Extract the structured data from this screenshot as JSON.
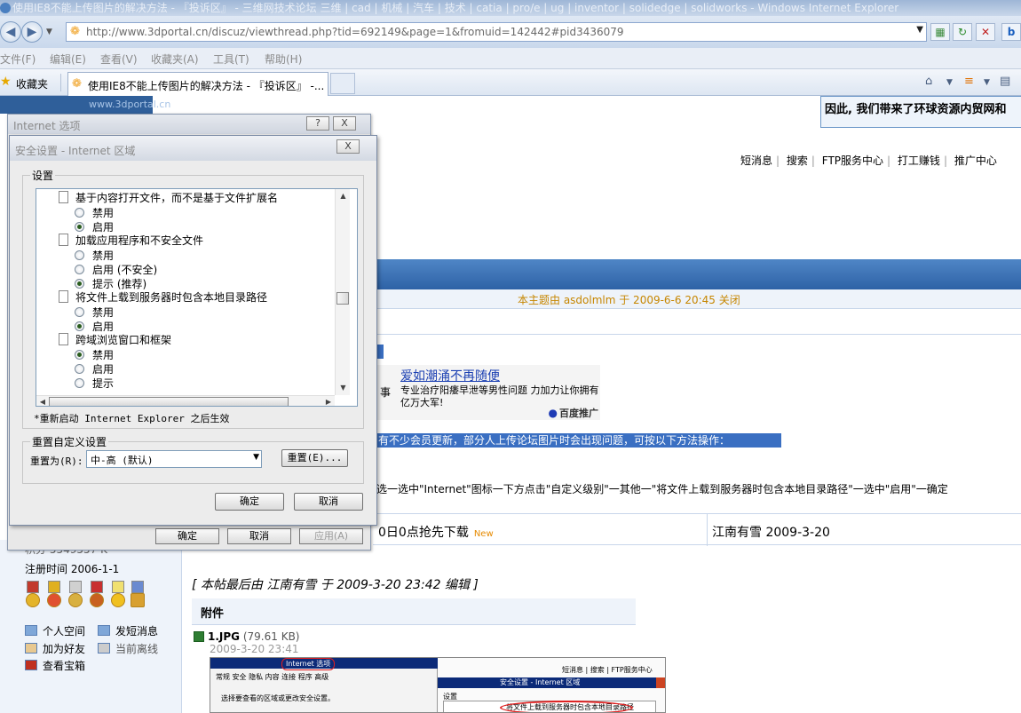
{
  "window": {
    "title": "使用IE8不能上传图片的解决方法 - 『投诉区』 - 三维网技术论坛 三维 | cad | 机械 | 汽车 | 技术 | catia | pro/e | ug | inventor | solidedge | solidworks - Windows Internet Explorer"
  },
  "address_bar": {
    "url": "http://www.3dportal.cn/discuz/viewthread.php?tid=692149&page=1&fromuid=142442#pid3436079"
  },
  "menu": [
    "文件(F)",
    "编辑(E)",
    "查看(V)",
    "收藏夹(A)",
    "工具(T)",
    "帮助(H)"
  ],
  "favorites": {
    "label": "收藏夹"
  },
  "tab": {
    "label": "使用IE8不能上传图片的解决方法 - 『投诉区』 -..."
  },
  "page": {
    "logo_text": "www.3dportal.cn",
    "banner": "因此, 我们带来了环球资源内贸网和",
    "topnav": [
      "短消息",
      "搜索",
      "FTP服务中心",
      "打工赚钱",
      "推广中心"
    ],
    "closed_notice": "本主题由 asdolmlm 于 2009-6-6 20:45 关闭",
    "ad": {
      "left_char": "事",
      "title": "爱如潮涌不再随便",
      "desc": "专业治疗阳痿早泄等男性问题 力加力让你拥有亿万大军!",
      "brand": "百度推广"
    },
    "highlighted_text": "有不少会员更新，部分人上传论坛图片时会出现问题，可按以下方法操作：",
    "instruction": "选一选中\"Internet\"图标一下方点击\"自定义级别\"一其他一\"将文件上载到服务器时包含本地目录路径\"一选中\"启用\"一确定",
    "row": {
      "title": "0日0点抢先下载",
      "new_badge": "New",
      "author": "江南有雪 2009-3-20"
    },
    "user": {
      "points": "积分 5549557 K",
      "reg": "注册时间  2006-1-1"
    },
    "links": [
      "个人空间",
      "发短消息",
      "加为好友",
      "当前离线",
      "查看宝箱"
    ],
    "edited": "[ 本帖最后由 江南有雪 于 2009-3-20 23:42 编辑 ]",
    "attachment_header": "附件",
    "attachment": {
      "name": "1.JPG",
      "size": "(79.61 KB)",
      "date": "2009-3-20 23:41"
    },
    "thumb": {
      "left_title": "Internet 选项",
      "left_tabs": "常规  安全  隐私  内容  连接  程序  高级",
      "left_text": "选择要查看的区域或更改安全设置。",
      "right_nav": "短消息  |  搜索  |  FTP服务中心",
      "right_title": "安全设置 - Internet 区域",
      "right_body": "设置",
      "right_item": "将文件上载到服务器时包含本地目录路径"
    }
  },
  "dialog_internet_options": {
    "title": "Internet 选项",
    "help": "?",
    "close": "X",
    "ok": "确定",
    "cancel": "取消",
    "apply": "应用(A)"
  },
  "dialog_security": {
    "title": "安全设置 - Internet 区域",
    "close": "X",
    "group_label": "设置",
    "items": [
      {
        "type": "head",
        "label": "基于内容打开文件，而不是基于文件扩展名"
      },
      {
        "type": "opt",
        "label": "禁用",
        "checked": false
      },
      {
        "type": "opt",
        "label": "启用",
        "checked": true
      },
      {
        "type": "head",
        "label": "加载应用程序和不安全文件"
      },
      {
        "type": "opt",
        "label": "禁用",
        "checked": false
      },
      {
        "type": "opt",
        "label": "启用 (不安全)",
        "checked": false
      },
      {
        "type": "opt",
        "label": "提示 (推荐)",
        "checked": true
      },
      {
        "type": "head",
        "label": "将文件上载到服务器时包含本地目录路径"
      },
      {
        "type": "opt",
        "label": "禁用",
        "checked": false
      },
      {
        "type": "opt",
        "label": "启用",
        "checked": true
      },
      {
        "type": "head",
        "label": "跨域浏览窗口和框架"
      },
      {
        "type": "opt",
        "label": "禁用",
        "checked": true
      },
      {
        "type": "opt",
        "label": "启用",
        "checked": false
      },
      {
        "type": "opt",
        "label": "提示",
        "checked": false
      }
    ],
    "restart_note": "*重新启动 Internet Explorer 之后生效",
    "reset_group_label": "重置自定义设置",
    "reset_to_label": "重置为(R):",
    "reset_value": "中-高 (默认)",
    "reset_button": "重置(E)...",
    "ok": "确定",
    "cancel": "取消"
  }
}
